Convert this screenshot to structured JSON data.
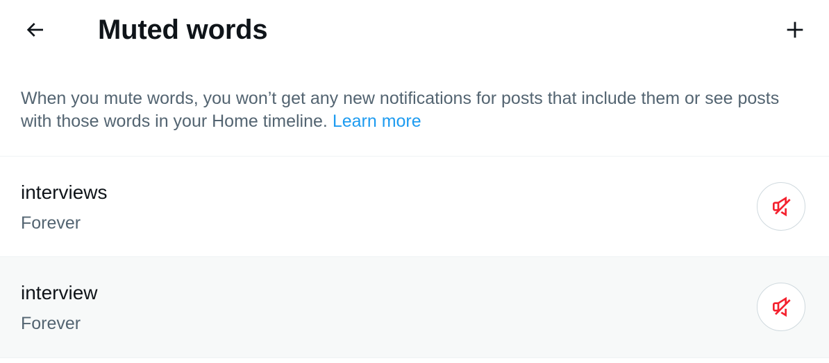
{
  "header": {
    "title": "Muted words",
    "back_icon": "arrow-left-icon",
    "add_icon": "plus-icon"
  },
  "description": {
    "text": "When you mute words, you won’t get any new notifications for posts that include them or see posts with those words in your Home timeline.",
    "link_label": "Learn more"
  },
  "muted_words": [
    {
      "word": "interviews",
      "duration": "Forever",
      "action_icon": "unmute-speaker-icon"
    },
    {
      "word": "interview",
      "duration": "Forever",
      "action_icon": "unmute-speaker-icon"
    }
  ],
  "colors": {
    "text_primary": "#0f1419",
    "text_secondary": "#536471",
    "link": "#1d9bf0",
    "unmute_icon": "#f4212e",
    "divider": "#eff3f4",
    "row_hover_bg": "#f7f9f9"
  }
}
